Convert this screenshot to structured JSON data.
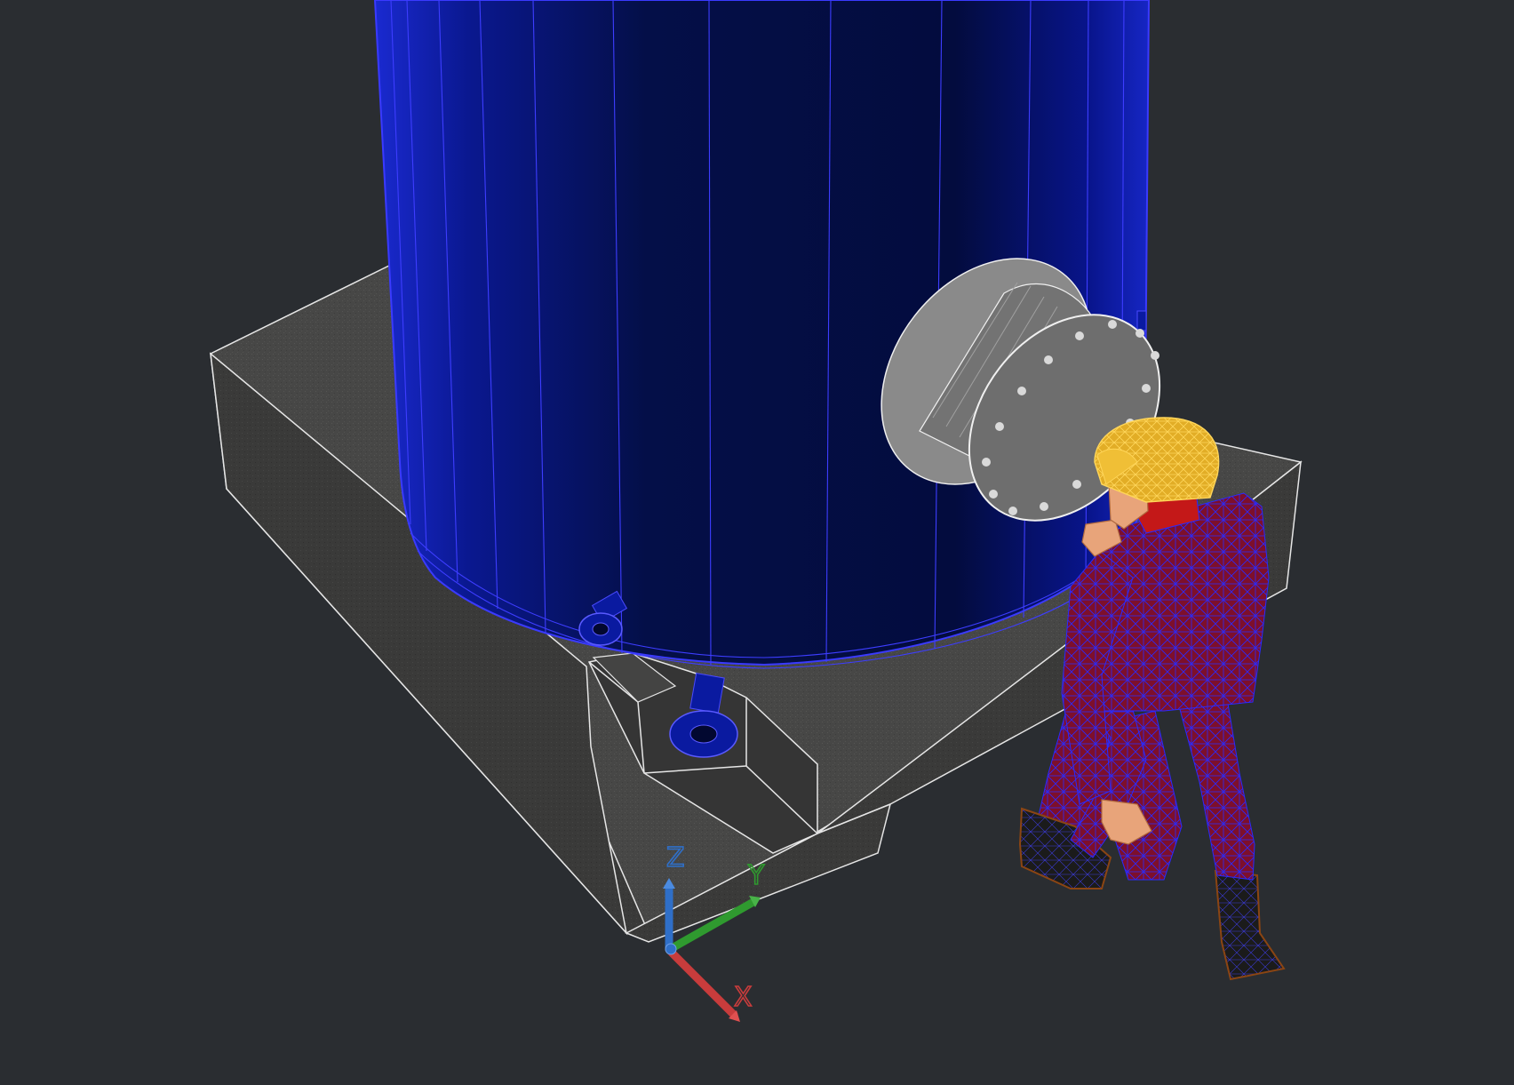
{
  "viewport": {
    "background_color": "#2a2d31"
  },
  "ucs_icon": {
    "axis_labels": {
      "x": "X",
      "y": "Y",
      "z": "Z"
    },
    "colors": {
      "x": "#c83c3c",
      "y": "#2f9a2f",
      "z": "#2f6fc8"
    }
  },
  "objects": {
    "vessel_color": "#051040",
    "vessel_wire_color": "#3a3aff",
    "foundation_color": "#4a4a49",
    "manway_color": "#6a6a6a",
    "worker_suit_color": "#8a0f2a",
    "hard_hat_color": "#e8b630"
  }
}
